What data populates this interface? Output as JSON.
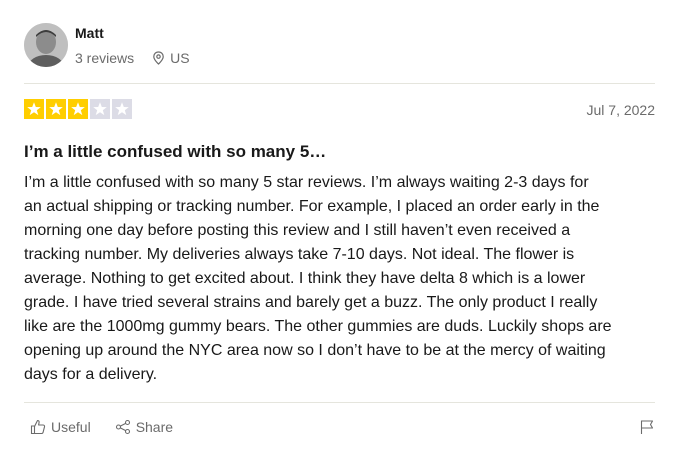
{
  "reviewer": {
    "name": "Matt",
    "review_count": "3 reviews",
    "location": "US"
  },
  "review": {
    "rating": 3,
    "max_rating": 5,
    "date": "Jul 7, 2022",
    "title": "I’m a little confused with so many 5…",
    "body_lines": [
      "I’m a little confused with so many 5 star reviews. I’m always waiting 2-3 days for",
      "an actual shipping or tracking number. For example, I placed an order early in the",
      "morning one day before posting this review and I still haven’t even received a",
      "tracking number. My deliveries always take 7-10 days. Not ideal. The flower is",
      "average. Nothing to get excited about. I think they have delta 8 which is a lower",
      "grade. I have tried several strains and barely get a buzz. The only product I really",
      "like are the 1000mg gummy bears. The other gummies are duds. Luckily shops are",
      "opening up around the NYC area now so I don’t have to be at the mercy of waiting",
      "days for a delivery."
    ]
  },
  "actions": {
    "useful_label": "Useful",
    "share_label": "Share"
  },
  "colors": {
    "star_filled": "#ffce00",
    "star_empty": "#dcdce6",
    "muted_text": "#6b6b6b",
    "divider": "#e5e5dd"
  },
  "icons": {
    "location": "location-pin-icon",
    "useful": "thumbs-up-icon",
    "share": "share-icon",
    "report": "flag-icon",
    "star": "star-icon"
  }
}
